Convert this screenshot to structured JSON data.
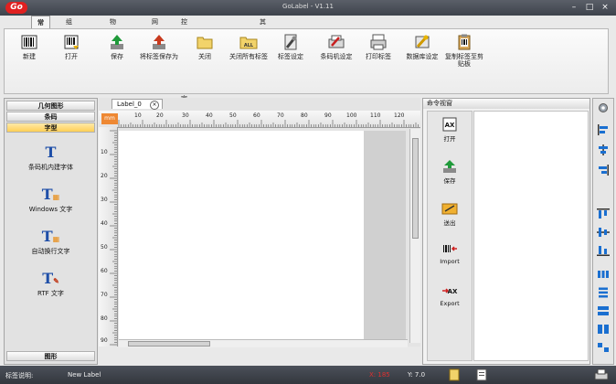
{
  "window": {
    "title": "GoLabel - V1.11",
    "logo": "Go"
  },
  "menu_tabs": [
    {
      "label": "常用",
      "active": true
    },
    {
      "label": "组件控制"
    },
    {
      "label": "物件对齐"
    },
    {
      "label": "网格"
    },
    {
      "label": "控制及参数设定"
    },
    {
      "label": "其他"
    }
  ],
  "toolbar": {
    "buttons": [
      {
        "label": "新建",
        "icon": "barcode-new-icon"
      },
      {
        "label": "打开",
        "icon": "barcode-open-icon"
      },
      {
        "label": "保存",
        "icon": "save-icon"
      },
      {
        "label": "将标签保存为",
        "icon": "save-as-icon"
      },
      {
        "label": "关闭",
        "icon": "folder-close-icon"
      },
      {
        "label": "关闭所有标签",
        "icon": "close-all-icon"
      },
      {
        "label": "标签设定",
        "icon": "label-settings-icon"
      },
      {
        "label": "条码机设定",
        "icon": "printer-settings-icon"
      },
      {
        "label": "打印标签",
        "icon": "print-icon"
      },
      {
        "label": "数据库设定",
        "icon": "database-settings-icon"
      },
      {
        "label": "复制标签至剪贴板",
        "icon": "copy-clipboard-icon"
      }
    ]
  },
  "left_panel": {
    "categories": [
      {
        "label": "几何图形"
      },
      {
        "label": "条码"
      },
      {
        "label": "字型",
        "selected": true
      }
    ],
    "tools": [
      {
        "label": "条码机内建字体"
      },
      {
        "label": "Windows 文字"
      },
      {
        "label": "自动换行文字"
      },
      {
        "label": "RTF 文字"
      }
    ],
    "bottom_category": "图形"
  },
  "document": {
    "tab_label": "Label_0",
    "ruler_unit": "mm",
    "h_ticks": [
      "10",
      "20",
      "30",
      "40",
      "50",
      "60",
      "70",
      "80",
      "90",
      "100",
      "110",
      "120"
    ],
    "v_ticks": [
      "10",
      "20",
      "30",
      "40",
      "50",
      "60",
      "70",
      "80",
      "90"
    ]
  },
  "command_panel": {
    "title": "命令视窗",
    "commands": [
      {
        "label": "打开"
      },
      {
        "label": "保存"
      },
      {
        "label": "送出"
      },
      {
        "label": "Import"
      },
      {
        "label": "Export"
      }
    ]
  },
  "status": {
    "label_caption": "标签说明:",
    "label_name": "New Label",
    "x_readout": "X: 185",
    "y_readout": "Y: 7.0"
  }
}
